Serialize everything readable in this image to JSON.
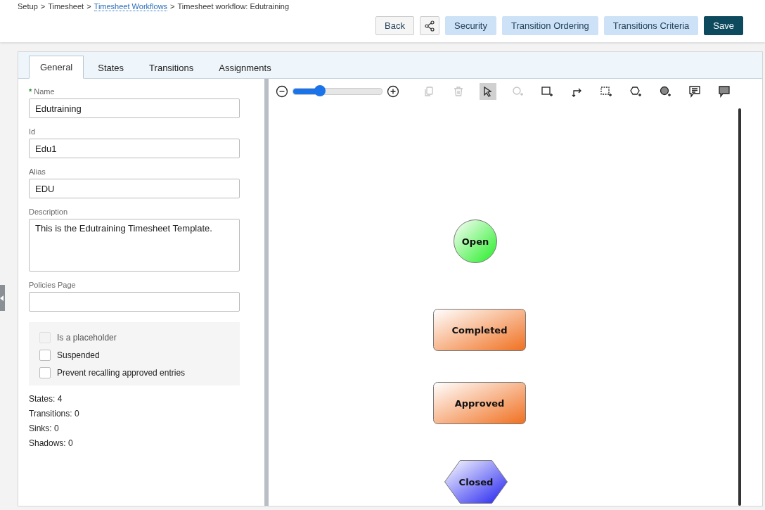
{
  "breadcrumb_separator": ">",
  "breadcrumb": [
    {
      "label": "Setup",
      "link": false
    },
    {
      "label": "Timesheet",
      "link": false
    },
    {
      "label": "Timesheet Workflows",
      "link": true
    },
    {
      "label": "Timesheet workflow: Edutraining",
      "link": false
    }
  ],
  "actions": [
    {
      "label": "Back",
      "kind": "plain"
    },
    {
      "kind": "share"
    },
    {
      "label": "Security",
      "kind": "light"
    },
    {
      "label": "Transition Ordering",
      "kind": "light"
    },
    {
      "label": "Transitions Criteria",
      "kind": "light"
    },
    {
      "label": "Save",
      "kind": "primary"
    }
  ],
  "tabs": [
    {
      "label": "General",
      "selected": true
    },
    {
      "label": "States",
      "selected": false
    },
    {
      "label": "Transitions",
      "selected": false
    },
    {
      "label": "Assignments",
      "selected": false
    }
  ],
  "fields": [
    {
      "label": "Name",
      "required_mark": "*",
      "value": "Edutraining",
      "kind": "input"
    },
    {
      "label": "Id",
      "value": "Edu1",
      "kind": "input"
    },
    {
      "label": "Alias",
      "value": "EDU",
      "kind": "input"
    },
    {
      "label": "Description",
      "value": "This is the Edutraining Timesheet Template.",
      "kind": "textarea"
    },
    {
      "label": "Policies Page",
      "kind": "input"
    }
  ],
  "options": [
    {
      "label": "Is a placeholder",
      "checked": false,
      "disabled": true
    },
    {
      "label": "Suspended",
      "checked": false,
      "disabled": false
    },
    {
      "label": "Prevent recalling approved entries",
      "checked": false,
      "disabled": false
    }
  ],
  "stats": [
    "States: 4",
    "Transitions: 0",
    "Sinks: 0",
    "Shadows: 0"
  ],
  "zoom": {
    "level": 0.3
  },
  "tools": [
    {
      "kind": "copy",
      "disabled": true,
      "selected": false
    },
    {
      "kind": "delete",
      "disabled": true,
      "selected": false
    },
    {
      "kind": "pointer",
      "disabled": false,
      "selected": true
    },
    {
      "kind": "add-circle",
      "disabled": true,
      "selected": false
    },
    {
      "kind": "add-rect",
      "disabled": false,
      "selected": false
    },
    {
      "kind": "connector",
      "disabled": false,
      "selected": false
    },
    {
      "kind": "add-dashed-rect",
      "disabled": false,
      "selected": false
    },
    {
      "kind": "add-hexagon",
      "disabled": false,
      "selected": false
    },
    {
      "kind": "add-shaded-circle",
      "disabled": false,
      "selected": false
    },
    {
      "kind": "comment",
      "disabled": false,
      "selected": false
    },
    {
      "kind": "shaded-comment",
      "disabled": false,
      "selected": false
    }
  ],
  "states": [
    {
      "label": "Open",
      "kind": "circle"
    },
    {
      "label": "Completed",
      "kind": "rect"
    },
    {
      "label": "Approved",
      "kind": "rect"
    },
    {
      "label": "Closed",
      "kind": "hexagon"
    }
  ]
}
